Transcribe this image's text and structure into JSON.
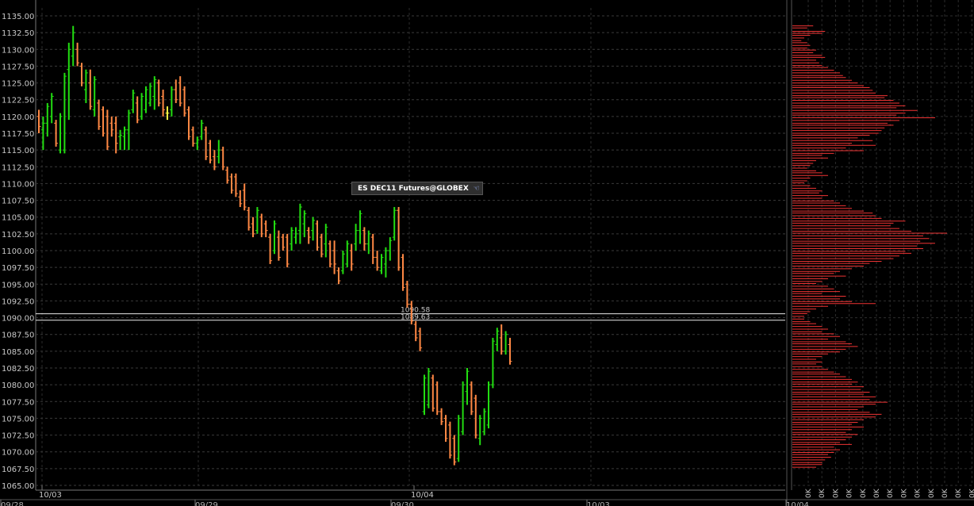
{
  "chart_data": {
    "type": "ohlc",
    "symbol_label": "ES DEC11 Futures@GLOBEX",
    "y_ticks": [
      "1135.00",
      "1132.50",
      "1130.00",
      "1127.50",
      "1125.00",
      "1122.50",
      "1120.00",
      "1117.50",
      "1115.00",
      "1112.50",
      "1110.00",
      "1107.50",
      "1105.00",
      "1102.50",
      "1100.00",
      "1097.50",
      "1095.00",
      "1092.50",
      "1090.00",
      "1087.50",
      "1085.00",
      "1082.50",
      "1080.00",
      "1077.50",
      "1075.00",
      "1072.50",
      "1070.00",
      "1067.50",
      "1065.00"
    ],
    "ylim": [
      1065,
      1135
    ],
    "x_labels_top": [
      "10/03",
      "10/04"
    ],
    "x_labels_bottom": [
      "09/28",
      "09/29",
      "09/30",
      "10/03",
      "10/04"
    ],
    "levels": [
      1090.58,
      1089.63
    ],
    "level_labels": [
      "1090.58",
      "1089.63"
    ],
    "up_color": "#22dd11",
    "down_color": "#ff8844",
    "doji_color": "#ffff44",
    "volume_profile_color": "#ee3333",
    "volume_axis_labels": [
      "0K",
      "0K",
      "0K",
      "0K",
      "0K",
      "0K",
      "0K",
      "0K",
      "0K",
      "0K",
      "0K",
      "0K",
      "0K"
    ],
    "volume_profile": [
      [
        1133.5,
        0.35
      ],
      [
        1133.2,
        0.25
      ],
      [
        1132.7,
        0.55
      ],
      [
        1132.4,
        0.5
      ],
      [
        1132.1,
        0.3
      ],
      [
        1131.7,
        0.2
      ],
      [
        1131.3,
        0.15
      ],
      [
        1131.0,
        0.25
      ],
      [
        1130.6,
        0.3
      ],
      [
        1130.2,
        0.25
      ],
      [
        1129.9,
        0.4
      ],
      [
        1129.5,
        0.35
      ],
      [
        1129.1,
        0.5
      ],
      [
        1128.8,
        0.55
      ],
      [
        1128.4,
        0.4
      ],
      [
        1128.0,
        0.45
      ],
      [
        1127.6,
        0.5
      ],
      [
        1127.3,
        0.6
      ],
      [
        1126.9,
        0.7
      ],
      [
        1126.5,
        0.8
      ],
      [
        1126.1,
        0.85
      ],
      [
        1125.8,
        0.9
      ],
      [
        1125.4,
        1.0
      ],
      [
        1125.0,
        1.1
      ],
      [
        1124.6,
        1.2
      ],
      [
        1124.3,
        1.3
      ],
      [
        1123.9,
        1.35
      ],
      [
        1123.5,
        1.4
      ],
      [
        1123.1,
        1.6
      ],
      [
        1122.8,
        1.55
      ],
      [
        1122.4,
        1.7
      ],
      [
        1122.0,
        1.8
      ],
      [
        1121.6,
        1.9
      ],
      [
        1121.3,
        1.75
      ],
      [
        1120.9,
        2.1
      ],
      [
        1120.5,
        1.9
      ],
      [
        1120.2,
        1.75
      ],
      [
        1119.8,
        2.4
      ],
      [
        1119.4,
        1.8
      ],
      [
        1119.0,
        1.6
      ],
      [
        1118.7,
        1.7
      ],
      [
        1118.3,
        1.55
      ],
      [
        1117.9,
        1.5
      ],
      [
        1117.5,
        1.45
      ],
      [
        1117.2,
        1.3
      ],
      [
        1116.8,
        1.1
      ],
      [
        1116.4,
        1.35
      ],
      [
        1116.0,
        1.0
      ],
      [
        1115.7,
        1.4
      ],
      [
        1115.3,
        0.9
      ],
      [
        1114.9,
        1.2
      ],
      [
        1114.5,
        0.7
      ],
      [
        1114.2,
        0.5
      ],
      [
        1113.8,
        0.6
      ],
      [
        1113.4,
        0.4
      ],
      [
        1113.0,
        0.35
      ],
      [
        1112.7,
        0.3
      ],
      [
        1112.3,
        0.25
      ],
      [
        1111.9,
        0.4
      ],
      [
        1111.6,
        0.5
      ],
      [
        1111.2,
        0.6
      ],
      [
        1110.8,
        0.3
      ],
      [
        1110.4,
        0.25
      ],
      [
        1110.1,
        0.2
      ],
      [
        1109.7,
        0.3
      ],
      [
        1109.3,
        0.4
      ],
      [
        1108.9,
        0.5
      ],
      [
        1108.6,
        0.45
      ],
      [
        1108.2,
        0.6
      ],
      [
        1107.8,
        0.5
      ],
      [
        1107.4,
        0.7
      ],
      [
        1107.1,
        0.8
      ],
      [
        1106.7,
        0.9
      ],
      [
        1106.3,
        1.0
      ],
      [
        1105.9,
        1.2
      ],
      [
        1105.6,
        1.35
      ],
      [
        1105.2,
        1.4
      ],
      [
        1104.8,
        1.5
      ],
      [
        1104.4,
        1.9
      ],
      [
        1104.1,
        1.7
      ],
      [
        1103.7,
        1.65
      ],
      [
        1103.3,
        1.8
      ],
      [
        1102.9,
        2.0
      ],
      [
        1102.6,
        2.6
      ],
      [
        1102.2,
        2.2
      ],
      [
        1101.8,
        2.3
      ],
      [
        1101.4,
        2.15
      ],
      [
        1101.1,
        2.4
      ],
      [
        1100.7,
        2.1
      ],
      [
        1100.3,
        2.2
      ],
      [
        1099.9,
        1.9
      ],
      [
        1099.6,
        2.0
      ],
      [
        1099.2,
        1.8
      ],
      [
        1098.8,
        1.7
      ],
      [
        1098.4,
        1.5
      ],
      [
        1098.1,
        1.3
      ],
      [
        1097.7,
        1.2
      ],
      [
        1097.3,
        1.0
      ],
      [
        1096.9,
        0.8
      ],
      [
        1096.6,
        0.7
      ],
      [
        1096.2,
        0.9
      ],
      [
        1095.8,
        0.6
      ],
      [
        1095.4,
        0.5
      ],
      [
        1095.1,
        0.4
      ],
      [
        1094.7,
        0.6
      ],
      [
        1094.3,
        0.7
      ],
      [
        1093.9,
        0.8
      ],
      [
        1093.6,
        0.5
      ],
      [
        1093.2,
        0.9
      ],
      [
        1092.8,
        0.8
      ],
      [
        1092.4,
        1.0
      ],
      [
        1092.1,
        1.4
      ],
      [
        1091.7,
        0.6
      ],
      [
        1091.3,
        0.4
      ],
      [
        1090.9,
        0.3
      ],
      [
        1090.6,
        0.25
      ],
      [
        1090.2,
        0.2
      ],
      [
        1089.8,
        0.2
      ],
      [
        1089.4,
        0.3
      ],
      [
        1089.1,
        0.4
      ],
      [
        1088.7,
        0.5
      ],
      [
        1088.3,
        0.6
      ],
      [
        1087.9,
        0.5
      ],
      [
        1087.6,
        0.7
      ],
      [
        1087.2,
        0.8
      ],
      [
        1086.8,
        0.6
      ],
      [
        1086.4,
        0.9
      ],
      [
        1086.1,
        1.0
      ],
      [
        1085.7,
        1.1
      ],
      [
        1085.3,
        0.9
      ],
      [
        1084.9,
        0.8
      ],
      [
        1084.6,
        0.6
      ],
      [
        1084.2,
        0.5
      ],
      [
        1083.8,
        0.4
      ],
      [
        1083.4,
        0.5
      ],
      [
        1083.1,
        0.4
      ],
      [
        1082.7,
        0.5
      ],
      [
        1082.3,
        0.6
      ],
      [
        1081.9,
        0.7
      ],
      [
        1081.6,
        0.8
      ],
      [
        1081.2,
        0.9
      ],
      [
        1080.8,
        1.0
      ],
      [
        1080.4,
        1.1
      ],
      [
        1080.1,
        1.0
      ],
      [
        1079.7,
        1.2
      ],
      [
        1079.3,
        1.15
      ],
      [
        1078.9,
        1.3
      ],
      [
        1078.6,
        1.2
      ],
      [
        1078.2,
        1.4
      ],
      [
        1077.8,
        1.3
      ],
      [
        1077.4,
        1.6
      ],
      [
        1077.1,
        1.4
      ],
      [
        1076.7,
        1.2
      ],
      [
        1076.3,
        1.1
      ],
      [
        1075.9,
        1.3
      ],
      [
        1075.6,
        1.5
      ],
      [
        1075.2,
        1.4
      ],
      [
        1074.8,
        1.2
      ],
      [
        1074.4,
        1.1
      ],
      [
        1074.1,
        1.0
      ],
      [
        1073.7,
        1.2
      ],
      [
        1073.3,
        1.0
      ],
      [
        1072.9,
        0.9
      ],
      [
        1072.6,
        1.1
      ],
      [
        1072.2,
        1.0
      ],
      [
        1071.8,
        0.9
      ],
      [
        1071.4,
        0.8
      ],
      [
        1071.1,
        1.0
      ],
      [
        1070.7,
        0.7
      ],
      [
        1070.3,
        0.8
      ],
      [
        1069.9,
        0.7
      ],
      [
        1069.6,
        0.6
      ],
      [
        1069.2,
        0.65
      ],
      [
        1068.8,
        0.55
      ],
      [
        1068.4,
        0.5
      ],
      [
        1068.1,
        0.5
      ],
      [
        1067.7,
        0.4
      ]
    ],
    "bars": [
      {
        "o": 1120,
        "h": 1121,
        "l": 1117.5,
        "c": 1118.5
      },
      {
        "o": 1118,
        "h": 1120,
        "l": 1115,
        "c": 1119
      },
      {
        "o": 1119,
        "h": 1122,
        "l": 1117,
        "c": 1121.5
      },
      {
        "o": 1120,
        "h": 1123.5,
        "l": 1119,
        "c": 1123
      },
      {
        "o": 1119,
        "h": 1119.5,
        "l": 1115.5,
        "c": 1116
      },
      {
        "o": 1115,
        "h": 1120.5,
        "l": 1114.5,
        "c": 1120
      },
      {
        "o": 1115,
        "h": 1126.5,
        "l": 1114.5,
        "c": 1126
      },
      {
        "o": 1127,
        "h": 1131,
        "l": 1119.5,
        "c": 1130
      },
      {
        "o": 1129,
        "h": 1133.5,
        "l": 1127.5,
        "c": 1132.5
      },
      {
        "o": 1130,
        "h": 1131,
        "l": 1127.5,
        "c": 1128
      },
      {
        "o": 1127.5,
        "h": 1128,
        "l": 1124.5,
        "c": 1125
      },
      {
        "o": 1124,
        "h": 1127,
        "l": 1122,
        "c": 1126.5
      },
      {
        "o": 1125,
        "h": 1127,
        "l": 1121,
        "c": 1121.5
      },
      {
        "o": 1121,
        "h": 1126,
        "l": 1120,
        "c": 1125.5
      },
      {
        "o": 1122,
        "h": 1122.5,
        "l": 1118,
        "c": 1118.5
      },
      {
        "o": 1121,
        "h": 1121.5,
        "l": 1117,
        "c": 1117.5
      },
      {
        "o": 1120,
        "h": 1121,
        "l": 1115,
        "c": 1115.5
      },
      {
        "o": 1119,
        "h": 1120,
        "l": 1117,
        "c": 1118
      },
      {
        "o": 1119,
        "h": 1120,
        "l": 1114.5,
        "c": 1116
      },
      {
        "o": 1117,
        "h": 1118,
        "l": 1115,
        "c": 1117.2
      },
      {
        "o": 1117,
        "h": 1118.5,
        "l": 1115,
        "c": 1118
      },
      {
        "o": 1118,
        "h": 1121,
        "l": 1115,
        "c": 1120.5
      },
      {
        "o": 1121,
        "h": 1124,
        "l": 1120.5,
        "c": 1123.5
      },
      {
        "o": 1122,
        "h": 1123,
        "l": 1119,
        "c": 1119.5
      },
      {
        "o": 1120,
        "h": 1123.5,
        "l": 1119.5,
        "c": 1123
      },
      {
        "o": 1121,
        "h": 1124.5,
        "l": 1120.5,
        "c": 1124
      },
      {
        "o": 1122,
        "h": 1125,
        "l": 1121.5,
        "c": 1124.5
      },
      {
        "o": 1123,
        "h": 1126,
        "l": 1121,
        "c": 1125.5
      },
      {
        "o": 1125,
        "h": 1125.5,
        "l": 1121.5,
        "c": 1122
      },
      {
        "o": 1123,
        "h": 1124,
        "l": 1120,
        "c": 1121
      },
      {
        "o": 1120.5,
        "h": 1121.5,
        "l": 1119.5,
        "c": 1120.5
      },
      {
        "o": 1121,
        "h": 1124.5,
        "l": 1120,
        "c": 1124
      },
      {
        "o": 1124,
        "h": 1125.5,
        "l": 1122,
        "c": 1122.5
      },
      {
        "o": 1125,
        "h": 1126,
        "l": 1121.5,
        "c": 1122
      },
      {
        "o": 1124,
        "h": 1124.5,
        "l": 1120,
        "c": 1120.5
      },
      {
        "o": 1121,
        "h": 1121.5,
        "l": 1116.5,
        "c": 1117
      },
      {
        "o": 1118,
        "h": 1118.5,
        "l": 1115.5,
        "c": 1116
      },
      {
        "o": 1116,
        "h": 1117,
        "l": 1115,
        "c": 1116.5
      },
      {
        "o": 1117,
        "h": 1119.5,
        "l": 1116.5,
        "c": 1119
      },
      {
        "o": 1118,
        "h": 1118.5,
        "l": 1113.5,
        "c": 1114
      },
      {
        "o": 1116,
        "h": 1116.5,
        "l": 1113,
        "c": 1113.5
      },
      {
        "o": 1114,
        "h": 1115,
        "l": 1112,
        "c": 1112.5
      },
      {
        "o": 1114,
        "h": 1116.5,
        "l": 1113,
        "c": 1115
      },
      {
        "o": 1115,
        "h": 1115.5,
        "l": 1112,
        "c": 1112.5
      },
      {
        "o": 1112,
        "h": 1112.5,
        "l": 1110,
        "c": 1110.5
      },
      {
        "o": 1111,
        "h": 1111.5,
        "l": 1108.5,
        "c": 1109
      },
      {
        "o": 1111,
        "h": 1111.5,
        "l": 1108,
        "c": 1108.5
      },
      {
        "o": 1108,
        "h": 1109,
        "l": 1106.5,
        "c": 1107
      },
      {
        "o": 1109,
        "h": 1110,
        "l": 1106,
        "c": 1106.5
      },
      {
        "o": 1106,
        "h": 1106.5,
        "l": 1103,
        "c": 1103.5
      },
      {
        "o": 1104,
        "h": 1105,
        "l": 1102,
        "c": 1102.5
      },
      {
        "o": 1103,
        "h": 1106.5,
        "l": 1102.5,
        "c": 1106
      },
      {
        "o": 1105,
        "h": 1105.5,
        "l": 1102,
        "c": 1102.5
      },
      {
        "o": 1104,
        "h": 1104.5,
        "l": 1102,
        "c": 1103
      },
      {
        "o": 1102,
        "h": 1102.5,
        "l": 1098,
        "c": 1098.5
      },
      {
        "o": 1100,
        "h": 1104.5,
        "l": 1099.5,
        "c": 1104
      },
      {
        "o": 1102,
        "h": 1103,
        "l": 1098.5,
        "c": 1099
      },
      {
        "o": 1102,
        "h": 1102.5,
        "l": 1100,
        "c": 1100.5
      },
      {
        "o": 1102,
        "h": 1102.5,
        "l": 1097.5,
        "c": 1098
      },
      {
        "o": 1101,
        "h": 1103.5,
        "l": 1100,
        "c": 1103
      },
      {
        "o": 1102,
        "h": 1103.5,
        "l": 1101,
        "c": 1102.5
      },
      {
        "o": 1103,
        "h": 1107,
        "l": 1101,
        "c": 1106.5
      },
      {
        "o": 1104,
        "h": 1106,
        "l": 1102,
        "c": 1105.5
      },
      {
        "o": 1103,
        "h": 1103.5,
        "l": 1101,
        "c": 1102
      },
      {
        "o": 1103,
        "h": 1105,
        "l": 1101.5,
        "c": 1104.5
      },
      {
        "o": 1104,
        "h": 1104.5,
        "l": 1100,
        "c": 1100.5
      },
      {
        "o": 1102,
        "h": 1102.5,
        "l": 1099,
        "c": 1099.5
      },
      {
        "o": 1101,
        "h": 1104,
        "l": 1099,
        "c": 1103.5
      },
      {
        "o": 1101,
        "h": 1101.5,
        "l": 1097.5,
        "c": 1098
      },
      {
        "o": 1100,
        "h": 1101.5,
        "l": 1096.5,
        "c": 1098
      },
      {
        "o": 1097,
        "h": 1097.5,
        "l": 1095,
        "c": 1095.5
      },
      {
        "o": 1097,
        "h": 1100,
        "l": 1096.5,
        "c": 1099.5
      },
      {
        "o": 1098,
        "h": 1101.5,
        "l": 1097.5,
        "c": 1101
      },
      {
        "o": 1100,
        "h": 1101,
        "l": 1097,
        "c": 1098
      },
      {
        "o": 1101,
        "h": 1104,
        "l": 1100,
        "c": 1103
      },
      {
        "o": 1103,
        "h": 1106,
        "l": 1101,
        "c": 1105.5
      },
      {
        "o": 1103,
        "h": 1103.5,
        "l": 1100,
        "c": 1101
      },
      {
        "o": 1101,
        "h": 1103,
        "l": 1099.5,
        "c": 1102.5
      },
      {
        "o": 1102,
        "h": 1102.5,
        "l": 1098,
        "c": 1099
      },
      {
        "o": 1099,
        "h": 1100,
        "l": 1097,
        "c": 1097.5
      },
      {
        "o": 1097,
        "h": 1099.5,
        "l": 1096.5,
        "c": 1099
      },
      {
        "o": 1098,
        "h": 1100.5,
        "l": 1096,
        "c": 1100
      },
      {
        "o": 1100,
        "h": 1102,
        "l": 1098.5,
        "c": 1101.5
      },
      {
        "o": 1102,
        "h": 1106.5,
        "l": 1101.5,
        "c": 1106
      },
      {
        "o": 1106,
        "h": 1106.5,
        "l": 1097,
        "c": 1097.5
      },
      {
        "o": 1099,
        "h": 1099.5,
        "l": 1094,
        "c": 1094.5
      },
      {
        "o": 1095,
        "h": 1095.5,
        "l": 1091.5,
        "c": 1092
      },
      {
        "o": 1092,
        "h": 1092.5,
        "l": 1089,
        "c": 1089.5
      },
      {
        "o": 1089,
        "h": 1089.5,
        "l": 1086.5,
        "c": 1087
      },
      {
        "o": 1088,
        "h": 1088.5,
        "l": 1085,
        "c": 1085.5
      },
      {
        "o": 1076,
        "h": 1081.5,
        "l": 1075.5,
        "c": 1081
      },
      {
        "o": 1077,
        "h": 1082.5,
        "l": 1076.5,
        "c": 1082
      },
      {
        "o": 1081,
        "h": 1081.5,
        "l": 1076,
        "c": 1076.5
      },
      {
        "o": 1080,
        "h": 1080.5,
        "l": 1075.5,
        "c": 1076
      },
      {
        "o": 1076,
        "h": 1076.5,
        "l": 1074,
        "c": 1074.5
      },
      {
        "o": 1075,
        "h": 1075.5,
        "l": 1071.5,
        "c": 1072
      },
      {
        "o": 1074,
        "h": 1074.5,
        "l": 1069,
        "c": 1069.5
      },
      {
        "o": 1072,
        "h": 1072.5,
        "l": 1068,
        "c": 1068.5
      },
      {
        "o": 1069,
        "h": 1075.5,
        "l": 1068.5,
        "c": 1075
      },
      {
        "o": 1073,
        "h": 1080.5,
        "l": 1072.5,
        "c": 1080
      },
      {
        "o": 1079,
        "h": 1082.5,
        "l": 1077,
        "c": 1082
      },
      {
        "o": 1080,
        "h": 1080.5,
        "l": 1075.5,
        "c": 1076
      },
      {
        "o": 1078,
        "h": 1078.5,
        "l": 1072,
        "c": 1072.5
      },
      {
        "o": 1072,
        "h": 1075.5,
        "l": 1071,
        "c": 1075
      },
      {
        "o": 1073,
        "h": 1076.5,
        "l": 1072.5,
        "c": 1076
      },
      {
        "o": 1074,
        "h": 1080.5,
        "l": 1073.5,
        "c": 1080
      },
      {
        "o": 1080,
        "h": 1087,
        "l": 1079.5,
        "c": 1086.5
      },
      {
        "o": 1086,
        "h": 1088.5,
        "l": 1085,
        "c": 1088
      },
      {
        "o": 1087,
        "h": 1089,
        "l": 1084.5,
        "c": 1085
      },
      {
        "o": 1085,
        "h": 1088,
        "l": 1084.5,
        "c": 1087.5
      },
      {
        "o": 1086,
        "h": 1087,
        "l": 1083,
        "c": 1083.5
      }
    ]
  }
}
